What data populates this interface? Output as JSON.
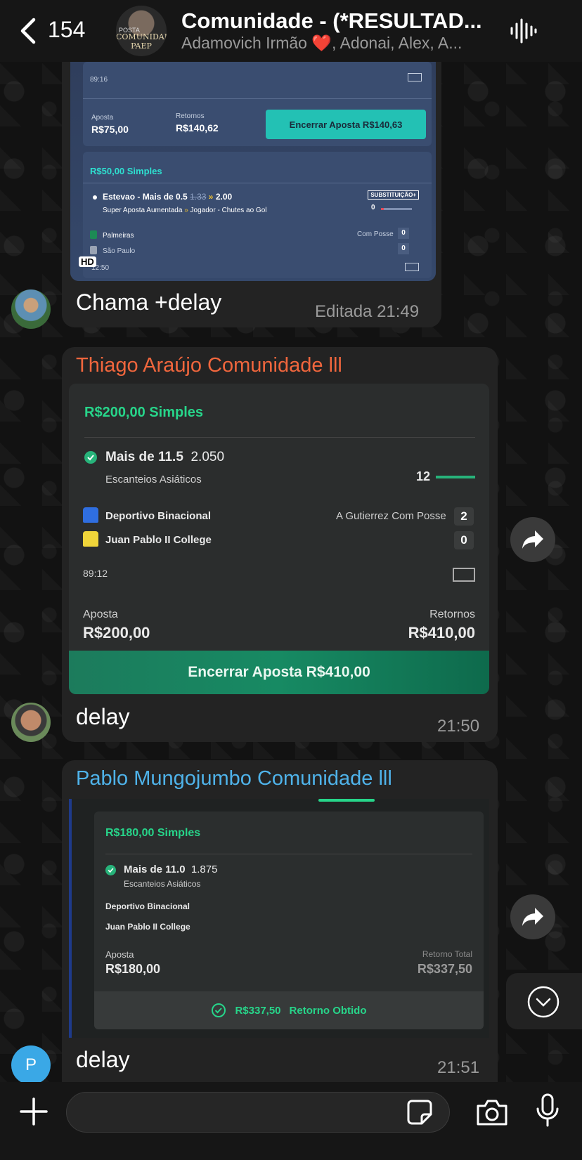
{
  "header": {
    "back_count": "154",
    "title": "Comunidade - (*RESULTAD...",
    "subtitle_a": "Adamovich Irmão ",
    "subtitle_heart": "❤️",
    "subtitle_b": ", Adonai, Alex, A...",
    "avatar_text": "COMUNIDADE PAEP",
    "avatar_small": "POSTA"
  },
  "messages": [
    {
      "text": "Chama +delay",
      "time": "Editada 21:49",
      "image": {
        "top_time": "89:16",
        "aposta_label": "Aposta",
        "aposta_value": "R$75,00",
        "retornos_label": "Retornos",
        "retornos_value": "R$140,62",
        "button": "Encerrar Aposta  R$140,63",
        "bet_title": "R$50,00  Simples",
        "selection": "Estevao - Mais de 0.5",
        "old_odd": "1.33",
        "new_odd": "2.00",
        "subst": "SUBSTITUIÇÃO+",
        "market": "Super Aposta Aumentada",
        "market_b": "Jogador - Chutes ao Gol",
        "progress_value": "0",
        "team1": "Palmeiras",
        "team2": "São Paulo",
        "possession": "Com Posse",
        "score1": "0",
        "score2": "0",
        "bottom_time": "12:50",
        "hd": "HD"
      }
    },
    {
      "sender": "Thiago Araújo Comunidade lll",
      "sender_color": "#f0663d",
      "text": "delay",
      "time": "21:50",
      "image": {
        "bet_title": "R$200,00  Simples",
        "selection": "Mais de 11.5",
        "odd": "2.050",
        "market": "Escanteios Asiáticos",
        "progress_value": "12",
        "team1": "Deportivo Binacional",
        "team2": "Juan Pablo II College",
        "possession": "A Gutierrez Com Posse",
        "score1": "2",
        "score2": "0",
        "match_time": "89:12",
        "aposta_label": "Aposta",
        "aposta_value": "R$200,00",
        "retornos_label": "Retornos",
        "retornos_value": "R$410,00",
        "button": "Encerrar Aposta   R$410,00"
      }
    },
    {
      "sender": "Pablo Mungojumbo Comunidade lll",
      "sender_color": "#4fb3ea",
      "text": "delay",
      "time": "21:51",
      "avatar_letter": "P",
      "image": {
        "bet_title": "R$180,00 Simples",
        "selection": "Mais de 11.0",
        "odd": "1.875",
        "market": "Escanteios Asiáticos",
        "team1": "Deportivo Binacional",
        "team2": "Juan Pablo II College",
        "aposta_label": "Aposta",
        "aposta_value": "R$180,00",
        "retorno_label": "Retorno Total",
        "retorno_value": "R$337,50",
        "footer_value": "R$337,50",
        "footer_label": "Retorno Obtido"
      }
    }
  ],
  "composer": {
    "placeholder": ""
  }
}
